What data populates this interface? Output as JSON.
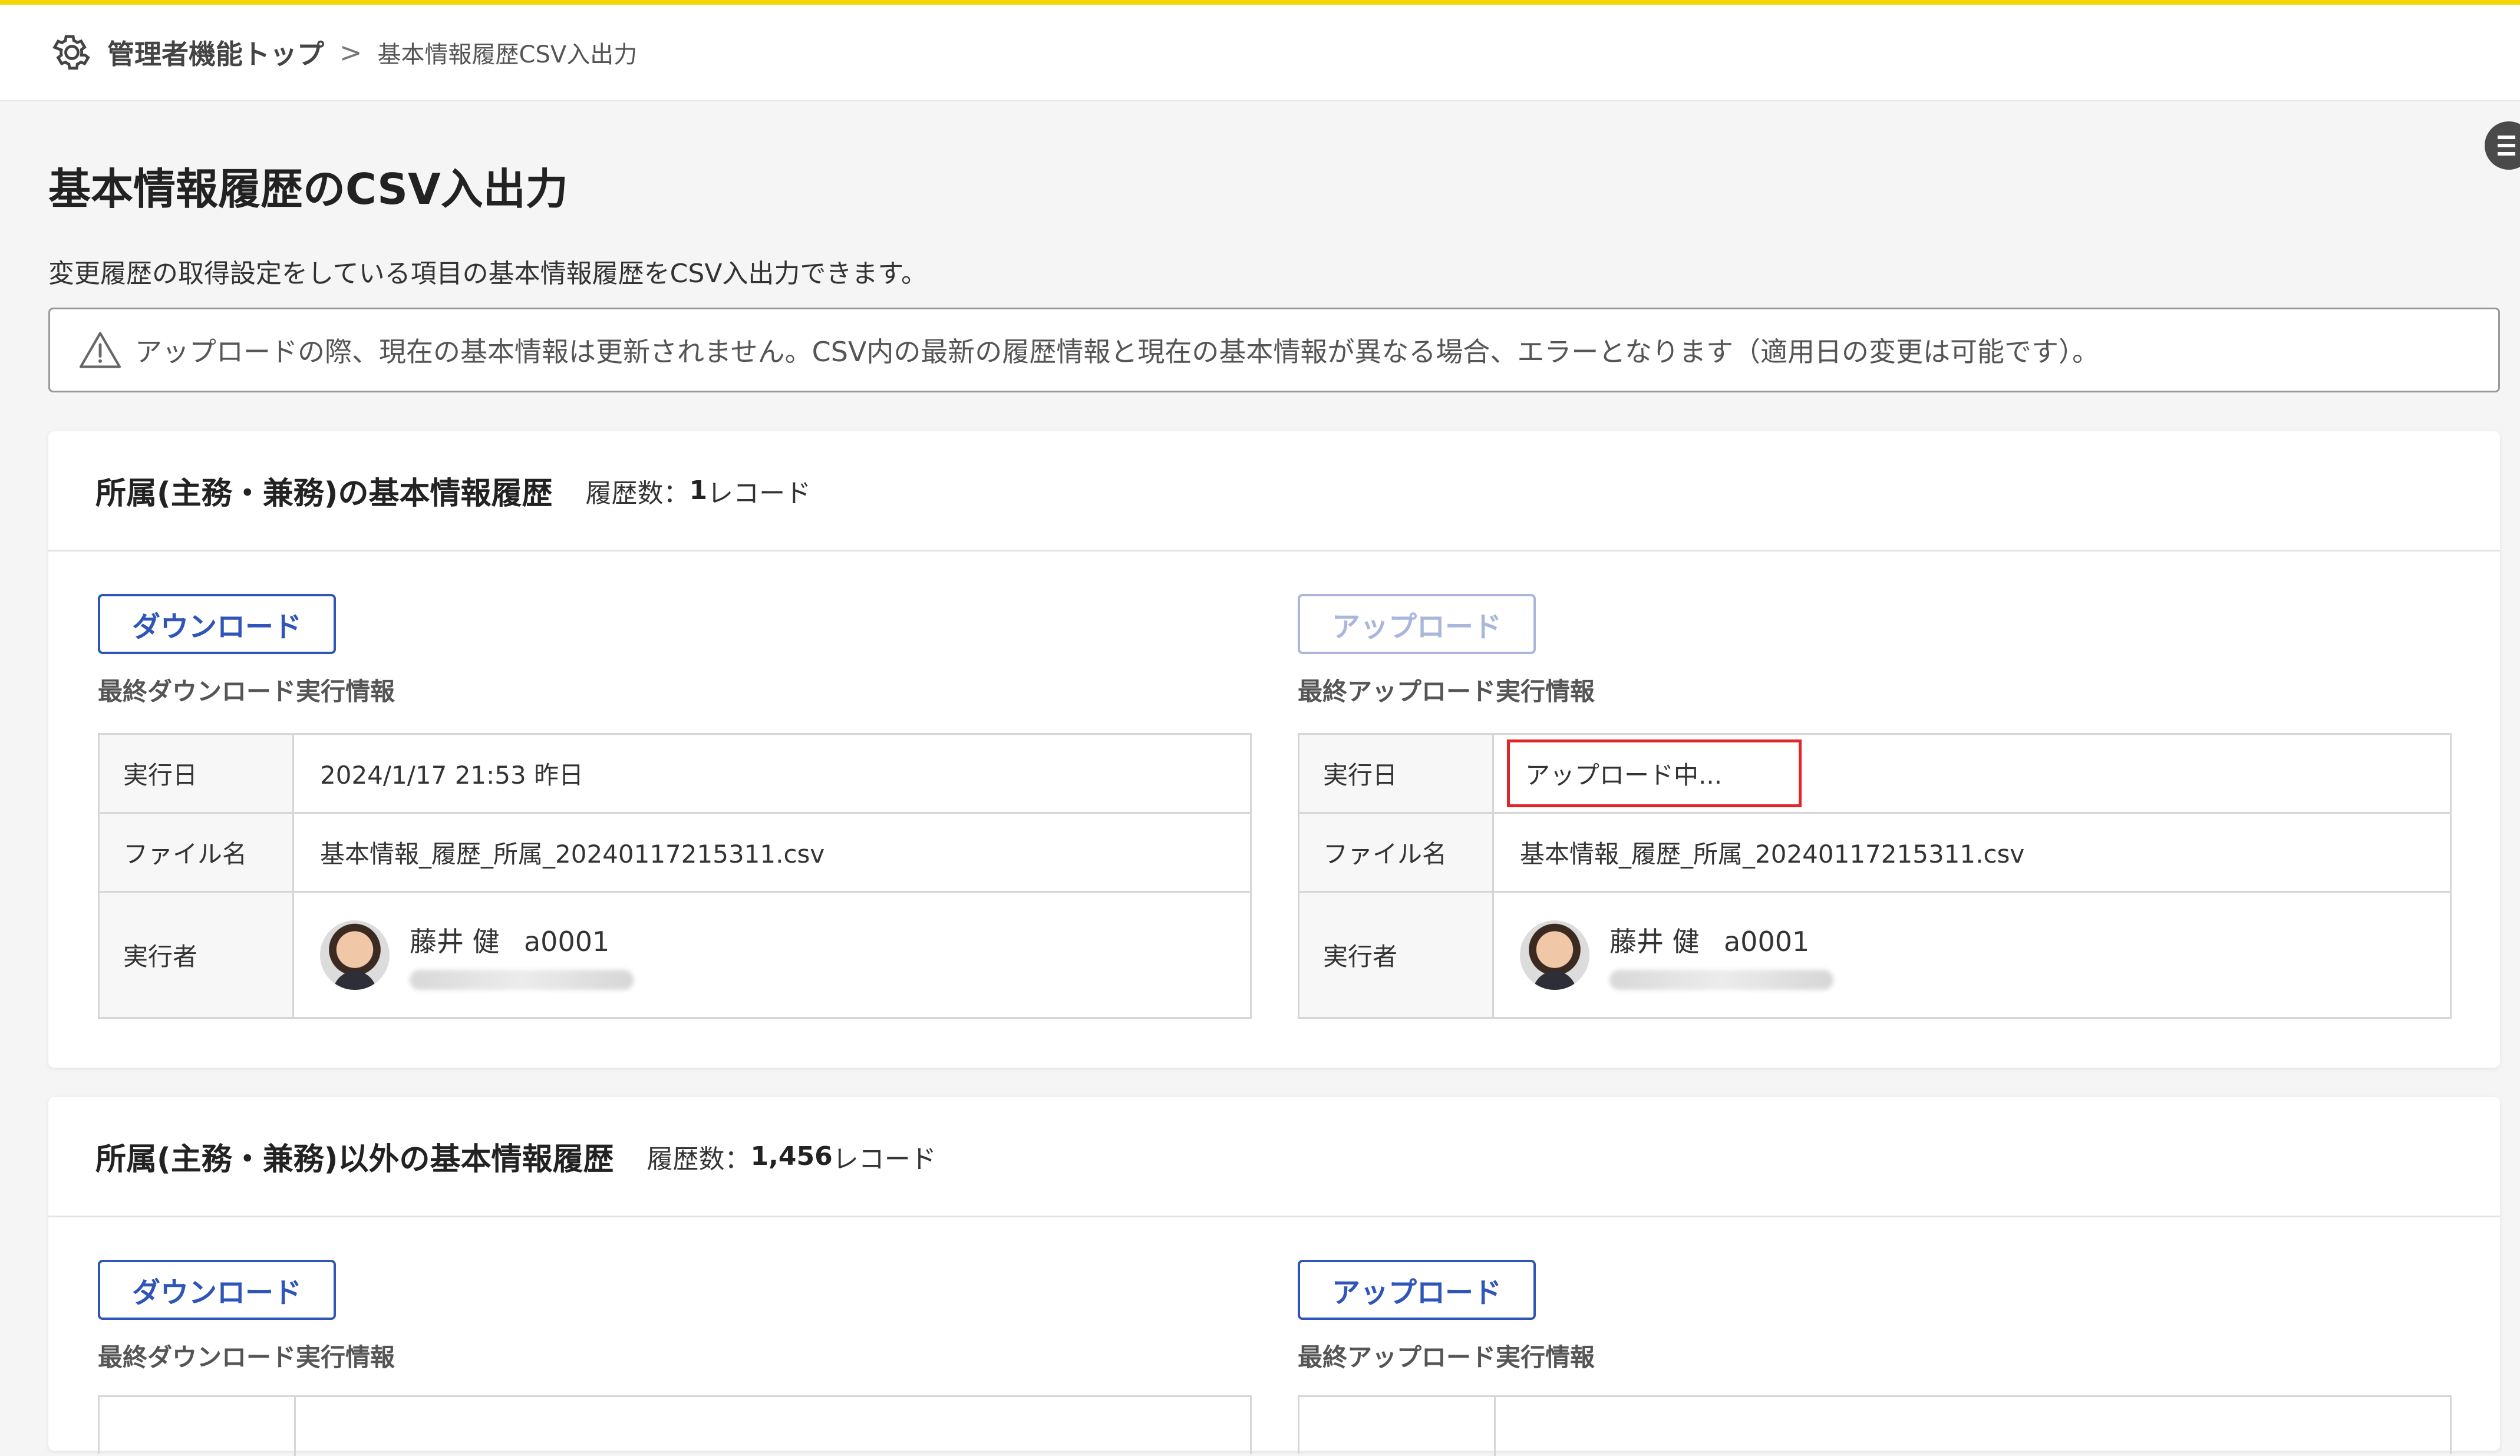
{
  "header": {
    "home_label": "管理者機能トップ",
    "separator": ">",
    "current_label": "基本情報履歴CSV入出力"
  },
  "page": {
    "title": "基本情報履歴のCSV入出力",
    "description": "変更履歴の取得設定をしている項目の基本情報履歴をCSV入出力できます。",
    "notice": "アップロードの際、現在の基本情報は更新されません。CSV内の最新の履歴情報と現在の基本情報が異なる場合、エラーとなります（適用日の変更は可能です）。"
  },
  "colors": {
    "accent": "#2f55b8",
    "top_bar": "#f5d40a",
    "highlight": "#e0262b"
  },
  "sections": [
    {
      "title": "所属(主務・兼務)の基本情報履歴",
      "count_label": "履歴数：",
      "count_value": "1",
      "count_unit": "レコード",
      "download": {
        "button_label": "ダウンロード",
        "info_label": "最終ダウンロード実行情報",
        "rows": {
          "date_key": "実行日",
          "date_value": "2024/1/17 21:53 昨日",
          "file_key": "ファイル名",
          "file_value": "基本情報_履歴_所属_20240117215311.csv",
          "user_key": "実行者",
          "user_name": "藤井 健",
          "user_id": "a0001"
        }
      },
      "upload": {
        "button_label": "アップロード",
        "button_state": "disabled",
        "info_label": "最終アップロード実行情報",
        "rows": {
          "date_key": "実行日",
          "date_value": "アップロード中...",
          "file_key": "ファイル名",
          "file_value": "基本情報_履歴_所属_20240117215311.csv",
          "user_key": "実行者",
          "user_name": "藤井 健",
          "user_id": "a0001"
        }
      }
    },
    {
      "title": "所属(主務・兼務)以外の基本情報履歴",
      "count_label": "履歴数：",
      "count_value": "1,456",
      "count_unit": "レコード",
      "download": {
        "button_label": "ダウンロード",
        "info_label": "最終ダウンロード実行情報"
      },
      "upload": {
        "button_label": "アップロード",
        "button_state": "enabled",
        "info_label": "最終アップロード実行情報"
      }
    }
  ]
}
